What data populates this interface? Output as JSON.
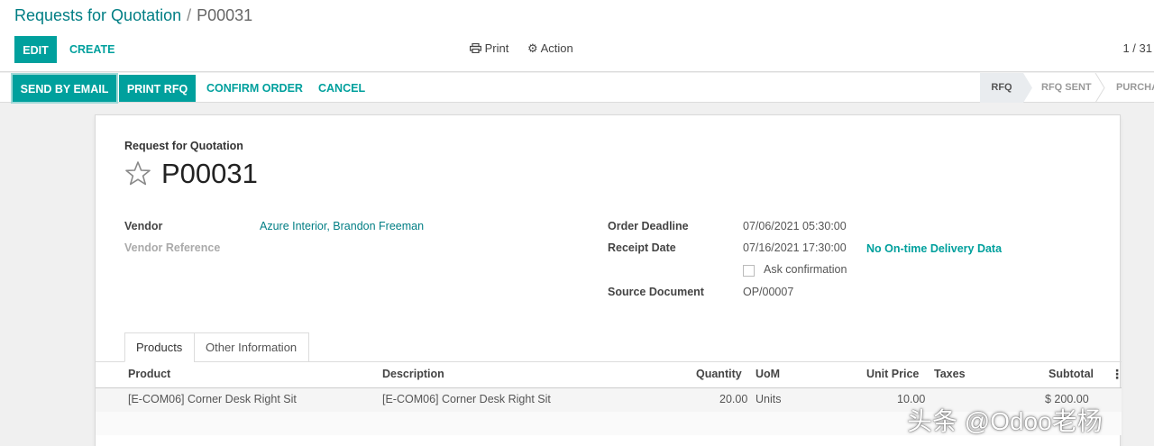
{
  "breadcrumb": {
    "parent": "Requests for Quotation",
    "separator": "/",
    "current": "P00031"
  },
  "toolbar": {
    "edit_label": "EDIT",
    "create_label": "CREATE",
    "print_label": "Print",
    "action_label": "Action",
    "pager": "1 / 31"
  },
  "actions": {
    "send_email": "SEND BY EMAIL",
    "print_rfq": "PRINT RFQ",
    "confirm_order": "CONFIRM ORDER",
    "cancel": "CANCEL"
  },
  "status": {
    "stages": [
      "RFQ",
      "RFQ SENT",
      "PURCHA"
    ],
    "active_index": 0
  },
  "form": {
    "doc_type": "Request for Quotation",
    "name": "P00031",
    "vendor_label": "Vendor",
    "vendor_value": "Azure Interior, Brandon Freeman",
    "vendor_ref_label": "Vendor Reference",
    "order_deadline_label": "Order Deadline",
    "order_deadline_value": "07/06/2021 05:30:00",
    "receipt_date_label": "Receipt Date",
    "receipt_date_value": "07/16/2021 17:30:00",
    "ontime_label": "No On-time Delivery Data",
    "ask_confirmation_label": "Ask confirmation",
    "source_doc_label": "Source Document",
    "source_doc_value": "OP/00007"
  },
  "tabs": [
    "Products",
    "Other Information"
  ],
  "table": {
    "headers": {
      "product": "Product",
      "description": "Description",
      "quantity": "Quantity",
      "uom": "UoM",
      "unit_price": "Unit Price",
      "taxes": "Taxes",
      "subtotal": "Subtotal"
    },
    "rows": [
      {
        "product": "[E-COM06] Corner Desk Right Sit",
        "description": "[E-COM06] Corner Desk Right Sit",
        "quantity": "20.00",
        "uom": "Units",
        "unit_price": "10.00",
        "subtotal": "$ 200.00"
      }
    ]
  },
  "watermark": "头条 @Odoo老杨",
  "colors": {
    "primary": "#00a09d",
    "link": "#017e84"
  }
}
